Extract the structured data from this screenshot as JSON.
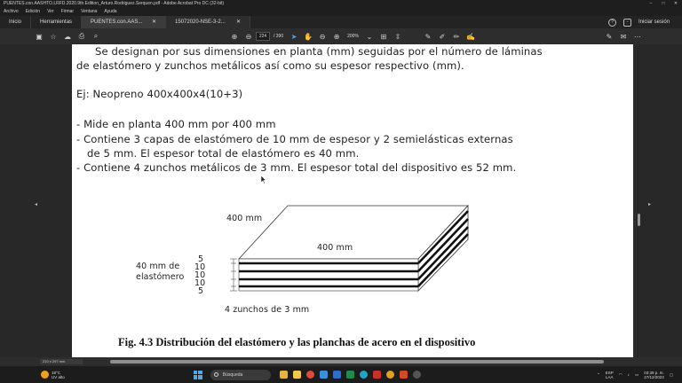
{
  "window": {
    "title": "PUENTES.con.AASHTO.LRFD.2020.9th.Edition_Arturo.Rodriguez.Serquen.pdf - Adobe Acrobat Pro DC (32-bit)"
  },
  "menu": [
    "Archivo",
    "Edición",
    "Ver",
    "Firmar",
    "Ventana",
    "Ayuda"
  ],
  "tabs": {
    "home": "Inicio",
    "tools": "Herramientas",
    "doc1": "PUENTES.con.AAS...",
    "doc2": "15072020-NSE-3-2..."
  },
  "header": {
    "signin": "Iniciar sesión"
  },
  "toolbar": {
    "page_current": "224",
    "page_total": "/ 390",
    "zoom": "200%"
  },
  "document": {
    "line1": "Se designan por sus dimensiones en planta (mm) seguidas por el número de láminas",
    "line2": "de elastómero y zunchos metálicos así como su espesor respectivo (mm).",
    "example": "Ej: Neopreno 400x400x4(10+3)",
    "bullet1": "- Mide en planta 400 mm por 400 mm",
    "bullet2a": "- Contiene 3 capas de elastómero de 10 mm de espesor y 2 semielásticas externas",
    "bullet2b": "de 5 mm. El espesor total de elastómero es 40 mm.",
    "bullet3": "- Contiene 4 zunchos metálicos de 3 mm. El espesor total del dispositivo es 52 mm.",
    "figure": {
      "dim_depth": "400 mm",
      "dim_width": "400 mm",
      "label_40": "40 mm de",
      "label_elast": "elastómero",
      "layers": [
        "5",
        "10",
        "10",
        "10",
        "5"
      ],
      "label_plates": "4 zunchos de 3 mm"
    },
    "caption": "Fig. 4.3  Distribución del elastómero y las planchas de acero en el dispositivo"
  },
  "status": {
    "page_size": "210 x 297 mm"
  },
  "taskbar": {
    "weather_temp": "18°C",
    "weather_desc": "UV alto",
    "search_placeholder": "Búsqueda",
    "lang": "ESP",
    "lang_sub": "LAA",
    "time": "03:39 p. m.",
    "date": "27/12/2023"
  },
  "colors": {
    "accent": "#4aa8f0",
    "page": "#ffffff",
    "chrome": "#2d2d2d"
  }
}
